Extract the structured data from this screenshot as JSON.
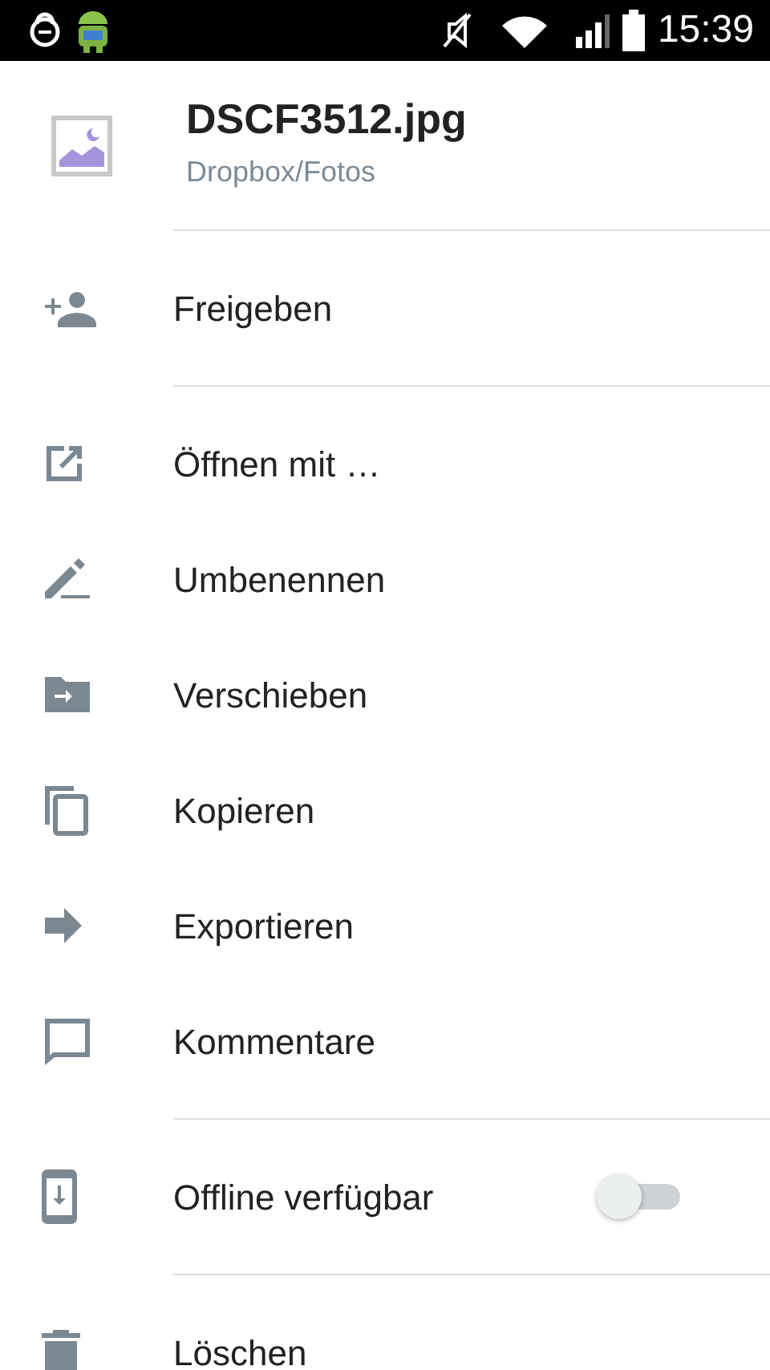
{
  "status_bar": {
    "time": "15:39"
  },
  "header": {
    "title": "DSCF3512.jpg",
    "subtitle": "Dropbox/Fotos"
  },
  "sections": [
    [
      {
        "label": "Freigeben",
        "kind": "action"
      }
    ],
    [
      {
        "label": "Öffnen mit …",
        "kind": "action"
      },
      {
        "label": "Umbenennen",
        "kind": "action"
      },
      {
        "label": "Verschieben",
        "kind": "action"
      },
      {
        "label": "Kopieren",
        "kind": "action"
      },
      {
        "label": "Exportieren",
        "kind": "action"
      },
      {
        "label": "Kommentare",
        "kind": "action"
      }
    ],
    [
      {
        "label": "Offline verfügbar",
        "kind": "toggle",
        "on": false
      }
    ],
    [
      {
        "label": "Löschen",
        "kind": "action"
      }
    ]
  ]
}
